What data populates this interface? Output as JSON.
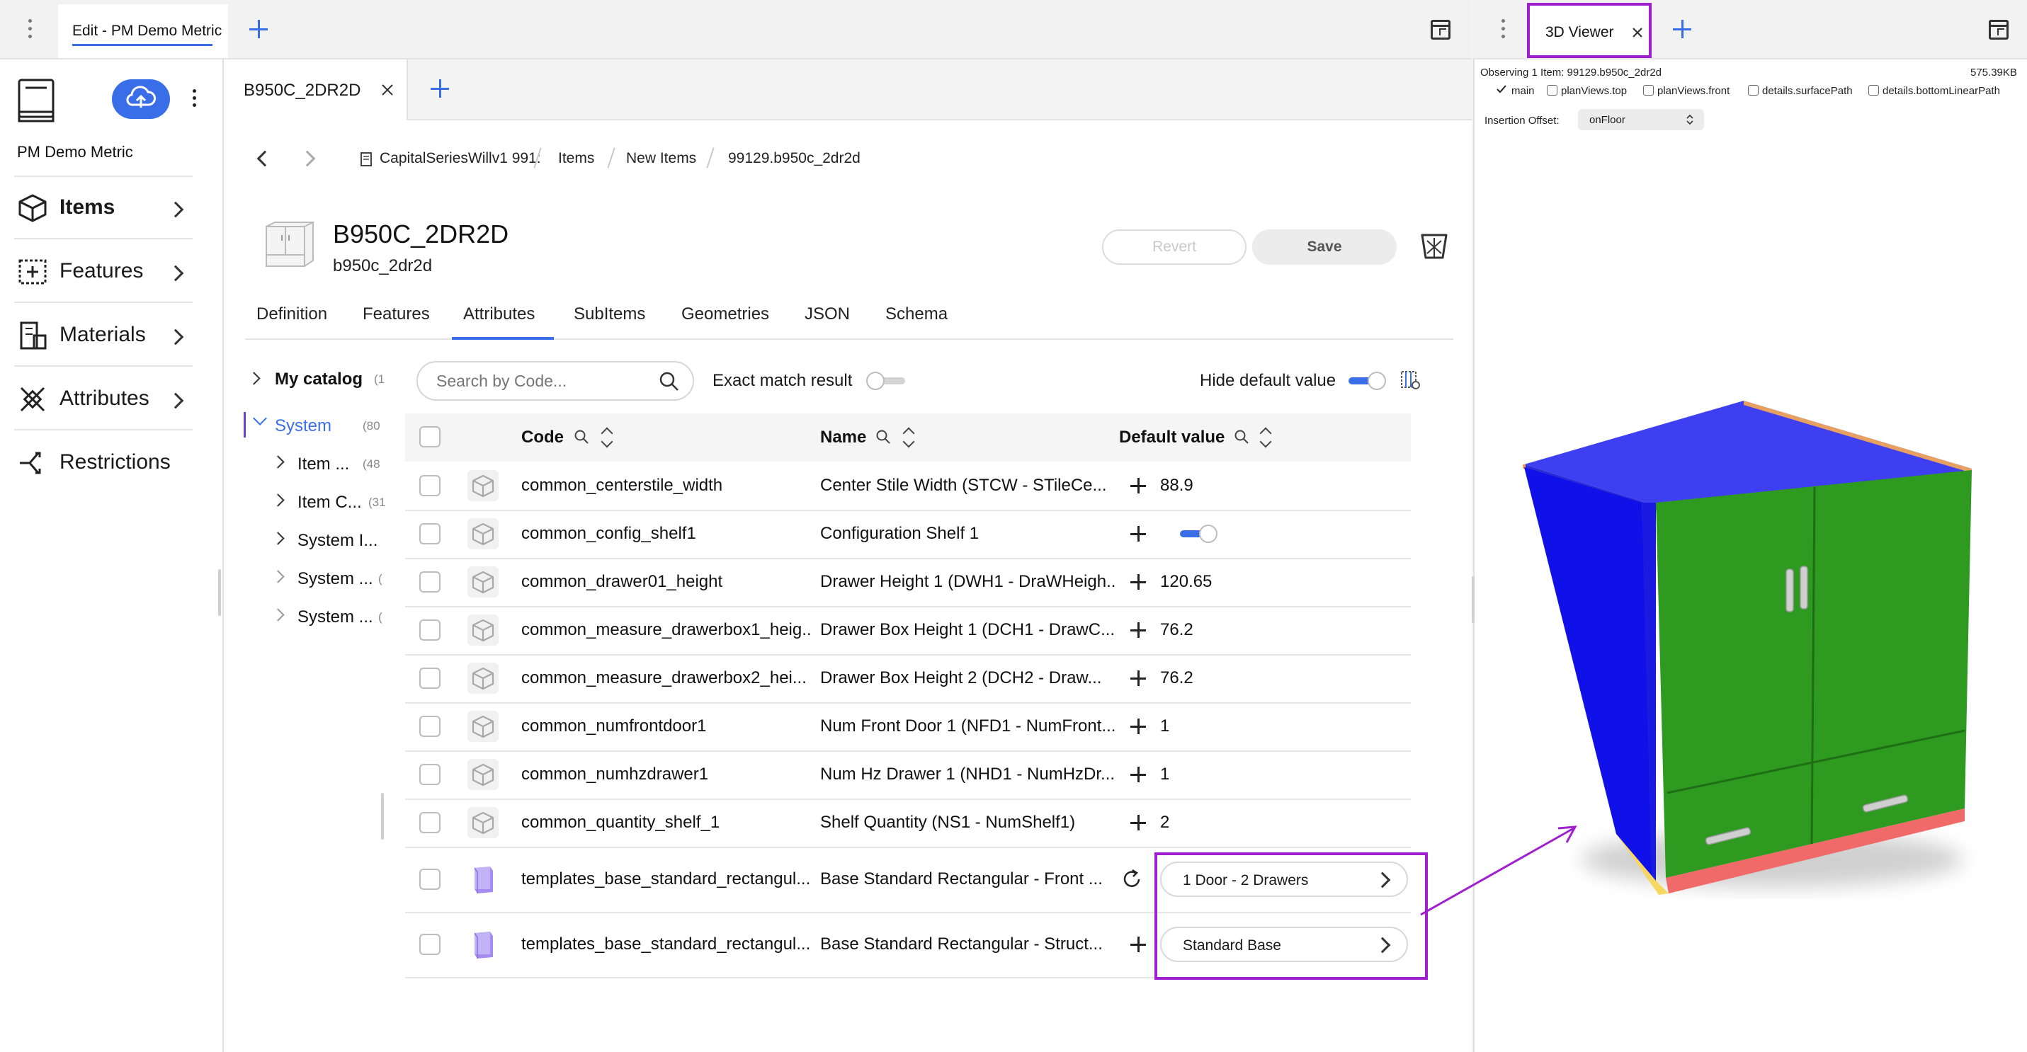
{
  "left_window": {
    "tab_label": "Edit - PM Demo Metric"
  },
  "sidebar": {
    "title": "PM Demo Metric",
    "items": [
      {
        "label": "Items",
        "icon": "cube-icon",
        "active": true
      },
      {
        "label": "Features",
        "icon": "features-icon"
      },
      {
        "label": "Materials",
        "icon": "materials-icon"
      },
      {
        "label": "Attributes",
        "icon": "attributes-icon"
      },
      {
        "label": "Restrictions",
        "icon": "restrictions-icon"
      }
    ]
  },
  "editor": {
    "tab_label": "B950C_2DR2D",
    "breadcrumb": [
      "CapitalSeriesWillv1 991:",
      "Items",
      "New Items",
      "99129.b950c_2dr2d"
    ],
    "item_title": "B950C_2DR2D",
    "item_subtitle": "b950c_2dr2d",
    "revert_label": "Revert",
    "save_label": "Save",
    "tabs": [
      "Definition",
      "Features",
      "Attributes",
      "SubItems",
      "Geometries",
      "JSON",
      "Schema"
    ],
    "active_tab": "Attributes"
  },
  "tree": {
    "root": {
      "label": "My catalog",
      "count": "(1"
    },
    "system": {
      "label": "System",
      "count": "(80"
    },
    "children": [
      {
        "label": "Item ...",
        "count": "(48"
      },
      {
        "label": "Item C...",
        "count": "(31"
      },
      {
        "label": "System I...",
        "count": ""
      },
      {
        "label": "System ...",
        "count": "("
      },
      {
        "label": "System ...",
        "count": "("
      }
    ]
  },
  "filters": {
    "search_placeholder": "Search by Code...",
    "exact_match_label": "Exact match result",
    "exact_match_on": false,
    "hide_default_label": "Hide default value",
    "hide_default_on": true
  },
  "table": {
    "headers": {
      "code": "Code",
      "name": "Name",
      "default": "Default value"
    },
    "rows": [
      {
        "code": "common_centerstile_width",
        "name": "Center Stile Width (STCW - STileCe...",
        "value": "88.9",
        "type": "number"
      },
      {
        "code": "common_config_shelf1",
        "name": "Configuration Shelf 1",
        "value": "",
        "type": "toggle"
      },
      {
        "code": "common_drawer01_height",
        "name": "Drawer Height 1 (DWH1 - DraWHeigh...",
        "value": "120.65",
        "type": "number"
      },
      {
        "code": "common_measure_drawerbox1_heig...",
        "name": "Drawer Box Height 1 (DCH1 - DrawC...",
        "value": "76.2",
        "type": "number"
      },
      {
        "code": "common_measure_drawerbox2_hei...",
        "name": "Drawer Box Height 2 (DCH2 - Draw...",
        "value": "76.2",
        "type": "number"
      },
      {
        "code": "common_numfrontdoor1",
        "name": "Num Front Door 1 (NFD1 - NumFront...",
        "value": "1",
        "type": "number"
      },
      {
        "code": "common_numhzdrawer1",
        "name": "Num Hz Drawer 1 (NHD1 - NumHzDr...",
        "value": "1",
        "type": "number"
      },
      {
        "code": "common_quantity_shelf_1",
        "name": "Shelf Quantity (NS1 - NumShelf1)",
        "value": "2",
        "type": "number"
      },
      {
        "code": "templates_base_standard_rectangul...",
        "name": "Base Standard Rectangular - Front ...",
        "value": "1 Door - 2 Drawers",
        "type": "reference"
      },
      {
        "code": "templates_base_standard_rectangul...",
        "name": "Base Standard Rectangular - Struct...",
        "value": "Standard Base",
        "type": "reference"
      }
    ]
  },
  "viewer": {
    "tab_label": "3D Viewer",
    "observing": "Observing 1 Item: 99129.b950c_2dr2d",
    "size": "575.39KB",
    "layers": [
      {
        "label": "main",
        "checked": true
      },
      {
        "label": "planViews.top",
        "checked": false
      },
      {
        "label": "planViews.front",
        "checked": false
      },
      {
        "label": "details.surfacePath",
        "checked": false
      },
      {
        "label": "details.bottomLinearPath",
        "checked": false
      }
    ],
    "insertion_label": "Insertion Offset:",
    "insertion_value": "onFloor"
  },
  "colors": {
    "accent": "#3a6ee8",
    "highlight": "#a020d0",
    "cabinet_top": "#3f3ff2",
    "cabinet_side": "#1010e8",
    "cabinet_front": "#2e9a20",
    "cabinet_plinth": "#f06a6a"
  }
}
